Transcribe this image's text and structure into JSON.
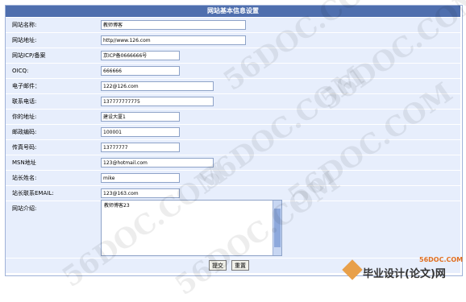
{
  "header": {
    "title": "网站基本信息设置"
  },
  "form": {
    "fields": [
      {
        "label": "网站名称:",
        "value": "教师博客"
      },
      {
        "label": "网站地址:",
        "value": "http//www.126.com"
      },
      {
        "label": "网站ICP/备案",
        "value": "京ICP备0666666号"
      },
      {
        "label": "OICQ:",
        "value": "666666"
      },
      {
        "label": "电子邮件：",
        "value": "122@126.com"
      },
      {
        "label": "联系电话:",
        "value": "137777777775"
      },
      {
        "label": "你的地址:",
        "value": "建设大厦1"
      },
      {
        "label": "邮政编码:",
        "value": "100001"
      },
      {
        "label": "传真号码:",
        "value": "13777777"
      },
      {
        "label": "MSN地址",
        "value": "123@hotmail.com"
      },
      {
        "label": "站长姓名:",
        "value": "mike"
      },
      {
        "label": "站长联系EMAIL:",
        "value": "123@163.com"
      }
    ],
    "intro": {
      "label": "网站介绍:",
      "value": "教师博客23"
    }
  },
  "buttons": {
    "submit": "提交",
    "reset": "重置"
  },
  "watermark": {
    "text": "56DOC.COM"
  },
  "footer_logo": {
    "domain": "56DOC.COM",
    "text": "毕业设计(论文)网"
  }
}
